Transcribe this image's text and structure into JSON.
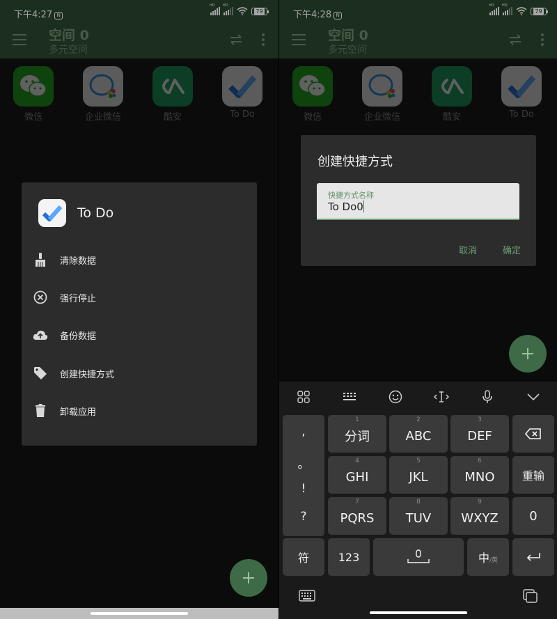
{
  "left": {
    "status": {
      "time": "下午4:27",
      "badge": "N",
      "battery": "79",
      "sim": "HD"
    },
    "appbar": {
      "title": "空间 0",
      "subtitle": "多元空间"
    },
    "apps": [
      {
        "label": "微信",
        "icon": "wechat-icon"
      },
      {
        "label": "企业微信",
        "icon": "wework-icon"
      },
      {
        "label": "酷安",
        "icon": "coolapk-icon"
      },
      {
        "label": "To Do",
        "icon": "todo-icon"
      }
    ],
    "sheet": {
      "title": "To Do",
      "items": [
        {
          "label": "清除数据",
          "icon": "broom-icon"
        },
        {
          "label": "强行停止",
          "icon": "close-circle-icon"
        },
        {
          "label": "备份数据",
          "icon": "cloud-upload-icon"
        },
        {
          "label": "创建快捷方式",
          "icon": "tag-icon"
        },
        {
          "label": "卸载应用",
          "icon": "trash-icon"
        }
      ]
    }
  },
  "right": {
    "status": {
      "time": "下午4:28",
      "badge": "N",
      "battery": "79",
      "sim": "HD"
    },
    "appbar": {
      "title": "空间 0",
      "subtitle": "多元空间"
    },
    "apps": [
      {
        "label": "微信",
        "icon": "wechat-icon"
      },
      {
        "label": "企业微信",
        "icon": "wework-icon"
      },
      {
        "label": "酷安",
        "icon": "coolapk-icon"
      },
      {
        "label": "To Do",
        "icon": "todo-icon"
      }
    ],
    "dialog": {
      "title": "创建快捷方式",
      "field_label": "快捷方式名称",
      "field_value": "To Do0",
      "cancel": "取消",
      "confirm": "确定"
    },
    "keyboard": {
      "punct": [
        ",",
        "。",
        "!",
        "?"
      ],
      "rows": [
        [
          {
            "num": "1",
            "label": "分词"
          },
          {
            "num": "2",
            "label": "ABC"
          },
          {
            "num": "3",
            "label": "DEF"
          }
        ],
        [
          {
            "num": "4",
            "label": "GHI"
          },
          {
            "num": "5",
            "label": "JKL"
          },
          {
            "num": "6",
            "label": "MNO"
          }
        ],
        [
          {
            "num": "7",
            "label": "PQRS"
          },
          {
            "num": "8",
            "label": "TUV"
          },
          {
            "num": "9",
            "label": "WXYZ"
          }
        ]
      ],
      "side": {
        "backspace": "⌫",
        "reenter": "重输",
        "zero": "0"
      },
      "bottom": {
        "symbols": "符",
        "numbers": "123",
        "lang": "中",
        "lang_small": "/英",
        "enter": "↵"
      }
    },
    "colors": {
      "appbar": "#2b472f",
      "accent": "#6d9e74",
      "fab": "#3e6a47"
    }
  }
}
